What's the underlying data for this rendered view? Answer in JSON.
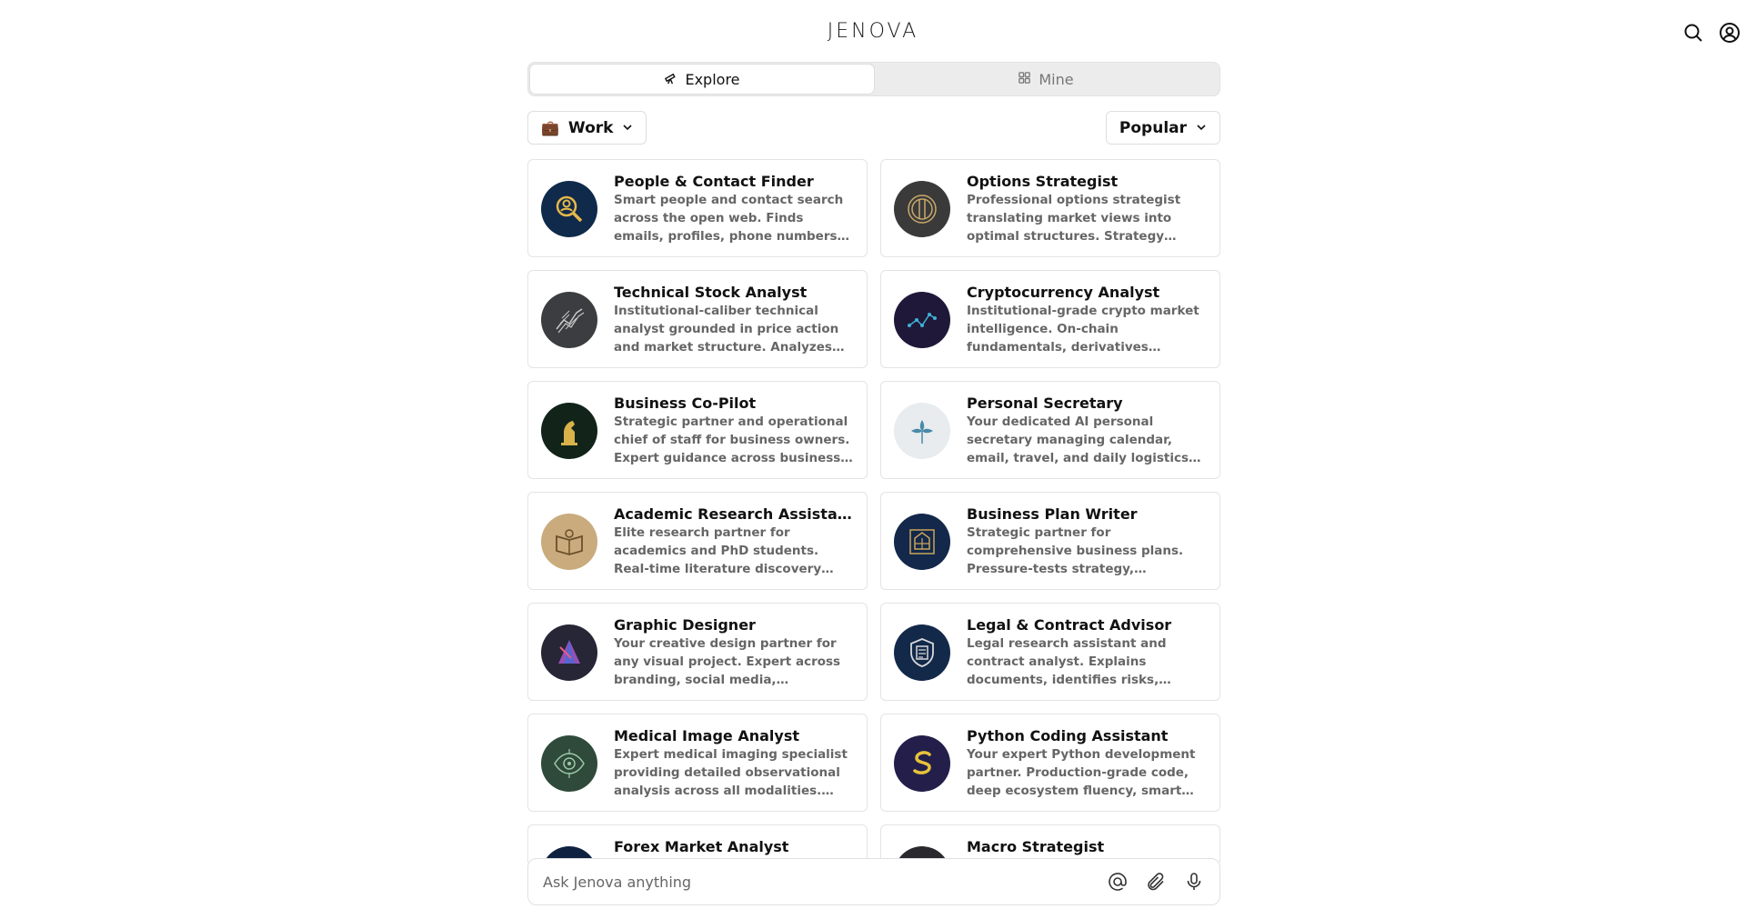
{
  "brand": "JENOVA",
  "tabs": {
    "explore": "Explore",
    "mine": "Mine"
  },
  "filters": {
    "category_icon": "💼",
    "category_label": "Work",
    "sort_label": "Popular"
  },
  "cards": [
    {
      "title": "People & Contact Finder",
      "desc": "Smart people and contact search across the open web. Finds emails, profiles, phone numbers, and…",
      "icon": "magnifier-person-icon",
      "bg": "#0f2a4a",
      "fg": "#e5b84a"
    },
    {
      "title": "Options Strategist",
      "desc": "Professional options strategist translating market views into optimal structures. Strategy…",
      "icon": "concentric-rings-icon",
      "bg": "#3a3a3a",
      "fg": "#c8a96a"
    },
    {
      "title": "Technical Stock Analyst",
      "desc": "Institutional-caliber technical analyst grounded in price action and market structure. Analyzes…",
      "icon": "chart-lines-icon",
      "bg": "#3b3d40",
      "fg": "#c9c9c9"
    },
    {
      "title": "Cryptocurrency Analyst",
      "desc": "Institutional-grade crypto market intelligence. On-chain fundamentals, derivatives…",
      "icon": "network-nodes-icon",
      "bg": "#1f1838",
      "fg": "#3fb0d6"
    },
    {
      "title": "Business Co-Pilot",
      "desc": "Strategic partner and operational chief of staff for business owners. Expert guidance across business…",
      "icon": "knight-icon",
      "bg": "#12241a",
      "fg": "#d9b24a"
    },
    {
      "title": "Personal Secretary",
      "desc": "Your dedicated AI personal secretary managing calendar, email, travel, and daily logistics…",
      "icon": "quill-flower-icon",
      "bg": "#e8ecee",
      "fg": "#4a8aa8"
    },
    {
      "title": "Academic Research Assistant",
      "desc": "Elite research partner for academics and PhD students. Real-time literature discovery across…",
      "icon": "open-book-icon",
      "bg": "#c9ab7e",
      "fg": "#6b4f2a"
    },
    {
      "title": "Business Plan Writer",
      "desc": "Strategic partner for comprehensive business plans. Pressure-tests strategy, validates…",
      "icon": "blueprint-icon",
      "bg": "#13284a",
      "fg": "#c9a45a"
    },
    {
      "title": "Graphic Designer",
      "desc": "Your creative design partner for any visual project. Expert across branding, social media, marketing…",
      "icon": "prism-icon",
      "bg": "#262636",
      "fg": "#b55ad6"
    },
    {
      "title": "Legal & Contract Advisor",
      "desc": "Legal research assistant and contract analyst. Explains documents, identifies risks, clarifi…",
      "icon": "shield-document-icon",
      "bg": "#13294a",
      "fg": "#d8d8d8"
    },
    {
      "title": "Medical Image Analyst",
      "desc": "Expert medical imaging specialist providing detailed observational analysis across all modalities.…",
      "icon": "eye-scan-icon",
      "bg": "#2f4a3a",
      "fg": "#9ac8a6"
    },
    {
      "title": "Python Coding Assistant",
      "desc": "Your expert Python development partner. Production-grade code, deep ecosystem fluency, smart…",
      "icon": "snake-icon",
      "bg": "#231f4a",
      "fg": "#e8c23a"
    },
    {
      "title": "Forex Market Analyst",
      "desc": "",
      "icon": "currency-icon",
      "bg": "#0f2240",
      "fg": "#c9a45a"
    },
    {
      "title": "Macro Strategist",
      "desc": "",
      "icon": "globe-icon",
      "bg": "#2a2a2e",
      "fg": "#c9c9c9"
    }
  ],
  "composer": {
    "placeholder": "Ask Jenova anything"
  }
}
